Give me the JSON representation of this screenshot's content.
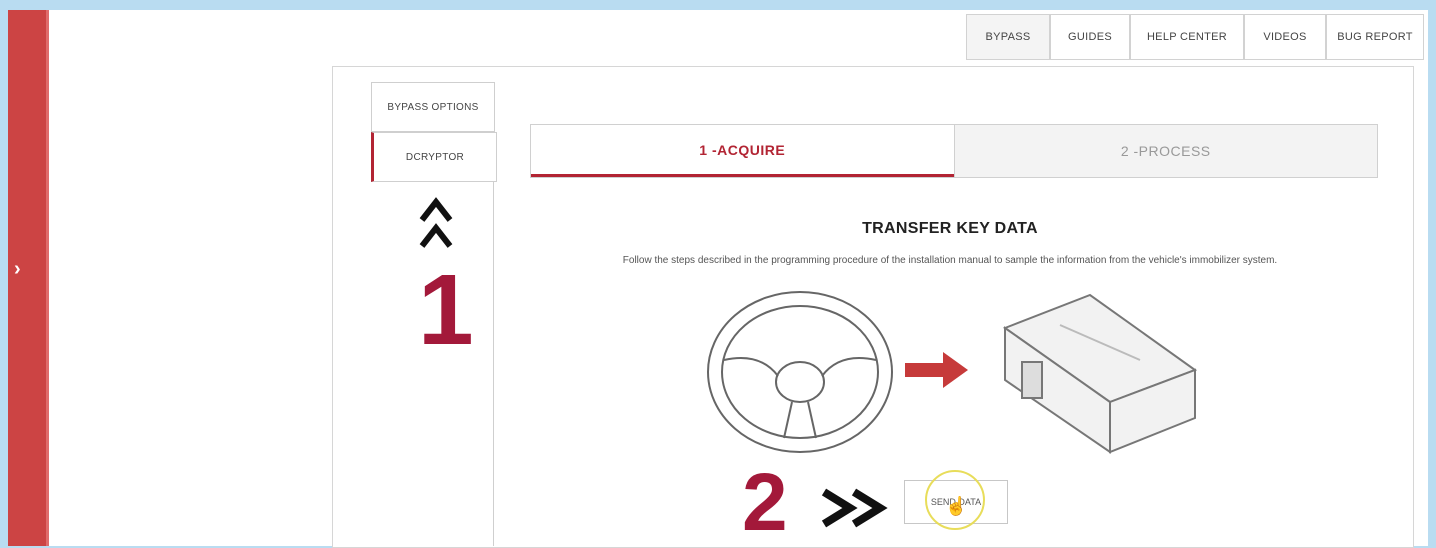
{
  "sidebar": {
    "toggle_icon": "chevron-right-icon"
  },
  "top_tabs": [
    {
      "label": "BYPASS"
    },
    {
      "label": "GUIDES"
    },
    {
      "label": "HELP CENTER"
    },
    {
      "label": "VIDEOS"
    },
    {
      "label": "BUG REPORT"
    }
  ],
  "left_tabs": [
    {
      "label": "BYPASS OPTIONS"
    },
    {
      "label": "DCRYPTOR"
    }
  ],
  "steps": [
    {
      "label": "1 -ACQUIRE"
    },
    {
      "label": "2 -PROCESS"
    }
  ],
  "content": {
    "heading": "TRANSFER KEY DATA",
    "description": "Follow the steps described in the programming procedure of the installation manual to sample the information from the vehicle's immobilizer system."
  },
  "send_button": {
    "label": "SEND DATA"
  },
  "annotations": {
    "marker_1": "1",
    "marker_2": "2"
  },
  "colors": {
    "brand_red": "#b22433",
    "sidebar_red": "#cc4444",
    "annotation_red": "#a3193a",
    "highlight_yellow": "#e8dd5a"
  }
}
